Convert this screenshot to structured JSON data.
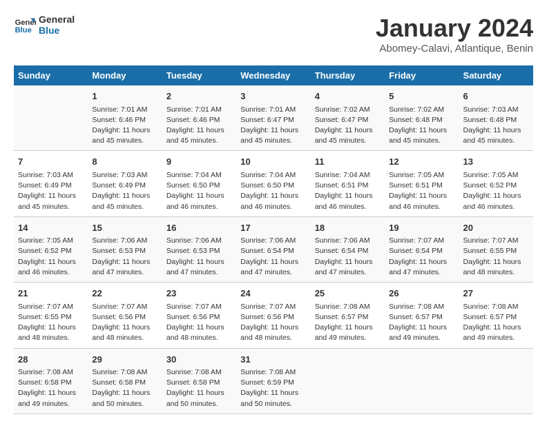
{
  "header": {
    "logo_line1": "General",
    "logo_line2": "Blue",
    "month": "January 2024",
    "location": "Abomey-Calavi, Atlantique, Benin"
  },
  "days_of_week": [
    "Sunday",
    "Monday",
    "Tuesday",
    "Wednesday",
    "Thursday",
    "Friday",
    "Saturday"
  ],
  "weeks": [
    [
      {
        "day": "",
        "content": ""
      },
      {
        "day": "1",
        "content": "Sunrise: 7:01 AM\nSunset: 6:46 PM\nDaylight: 11 hours\nand 45 minutes."
      },
      {
        "day": "2",
        "content": "Sunrise: 7:01 AM\nSunset: 6:46 PM\nDaylight: 11 hours\nand 45 minutes."
      },
      {
        "day": "3",
        "content": "Sunrise: 7:01 AM\nSunset: 6:47 PM\nDaylight: 11 hours\nand 45 minutes."
      },
      {
        "day": "4",
        "content": "Sunrise: 7:02 AM\nSunset: 6:47 PM\nDaylight: 11 hours\nand 45 minutes."
      },
      {
        "day": "5",
        "content": "Sunrise: 7:02 AM\nSunset: 6:48 PM\nDaylight: 11 hours\nand 45 minutes."
      },
      {
        "day": "6",
        "content": "Sunrise: 7:03 AM\nSunset: 6:48 PM\nDaylight: 11 hours\nand 45 minutes."
      }
    ],
    [
      {
        "day": "7",
        "content": "Sunrise: 7:03 AM\nSunset: 6:49 PM\nDaylight: 11 hours\nand 45 minutes."
      },
      {
        "day": "8",
        "content": "Sunrise: 7:03 AM\nSunset: 6:49 PM\nDaylight: 11 hours\nand 45 minutes."
      },
      {
        "day": "9",
        "content": "Sunrise: 7:04 AM\nSunset: 6:50 PM\nDaylight: 11 hours\nand 46 minutes."
      },
      {
        "day": "10",
        "content": "Sunrise: 7:04 AM\nSunset: 6:50 PM\nDaylight: 11 hours\nand 46 minutes."
      },
      {
        "day": "11",
        "content": "Sunrise: 7:04 AM\nSunset: 6:51 PM\nDaylight: 11 hours\nand 46 minutes."
      },
      {
        "day": "12",
        "content": "Sunrise: 7:05 AM\nSunset: 6:51 PM\nDaylight: 11 hours\nand 46 minutes."
      },
      {
        "day": "13",
        "content": "Sunrise: 7:05 AM\nSunset: 6:52 PM\nDaylight: 11 hours\nand 46 minutes."
      }
    ],
    [
      {
        "day": "14",
        "content": "Sunrise: 7:05 AM\nSunset: 6:52 PM\nDaylight: 11 hours\nand 46 minutes."
      },
      {
        "day": "15",
        "content": "Sunrise: 7:06 AM\nSunset: 6:53 PM\nDaylight: 11 hours\nand 47 minutes."
      },
      {
        "day": "16",
        "content": "Sunrise: 7:06 AM\nSunset: 6:53 PM\nDaylight: 11 hours\nand 47 minutes."
      },
      {
        "day": "17",
        "content": "Sunrise: 7:06 AM\nSunset: 6:54 PM\nDaylight: 11 hours\nand 47 minutes."
      },
      {
        "day": "18",
        "content": "Sunrise: 7:06 AM\nSunset: 6:54 PM\nDaylight: 11 hours\nand 47 minutes."
      },
      {
        "day": "19",
        "content": "Sunrise: 7:07 AM\nSunset: 6:54 PM\nDaylight: 11 hours\nand 47 minutes."
      },
      {
        "day": "20",
        "content": "Sunrise: 7:07 AM\nSunset: 6:55 PM\nDaylight: 11 hours\nand 48 minutes."
      }
    ],
    [
      {
        "day": "21",
        "content": "Sunrise: 7:07 AM\nSunset: 6:55 PM\nDaylight: 11 hours\nand 48 minutes."
      },
      {
        "day": "22",
        "content": "Sunrise: 7:07 AM\nSunset: 6:56 PM\nDaylight: 11 hours\nand 48 minutes."
      },
      {
        "day": "23",
        "content": "Sunrise: 7:07 AM\nSunset: 6:56 PM\nDaylight: 11 hours\nand 48 minutes."
      },
      {
        "day": "24",
        "content": "Sunrise: 7:07 AM\nSunset: 6:56 PM\nDaylight: 11 hours\nand 48 minutes."
      },
      {
        "day": "25",
        "content": "Sunrise: 7:08 AM\nSunset: 6:57 PM\nDaylight: 11 hours\nand 49 minutes."
      },
      {
        "day": "26",
        "content": "Sunrise: 7:08 AM\nSunset: 6:57 PM\nDaylight: 11 hours\nand 49 minutes."
      },
      {
        "day": "27",
        "content": "Sunrise: 7:08 AM\nSunset: 6:57 PM\nDaylight: 11 hours\nand 49 minutes."
      }
    ],
    [
      {
        "day": "28",
        "content": "Sunrise: 7:08 AM\nSunset: 6:58 PM\nDaylight: 11 hours\nand 49 minutes."
      },
      {
        "day": "29",
        "content": "Sunrise: 7:08 AM\nSunset: 6:58 PM\nDaylight: 11 hours\nand 50 minutes."
      },
      {
        "day": "30",
        "content": "Sunrise: 7:08 AM\nSunset: 6:58 PM\nDaylight: 11 hours\nand 50 minutes."
      },
      {
        "day": "31",
        "content": "Sunrise: 7:08 AM\nSunset: 6:59 PM\nDaylight: 11 hours\nand 50 minutes."
      },
      {
        "day": "",
        "content": ""
      },
      {
        "day": "",
        "content": ""
      },
      {
        "day": "",
        "content": ""
      }
    ]
  ]
}
